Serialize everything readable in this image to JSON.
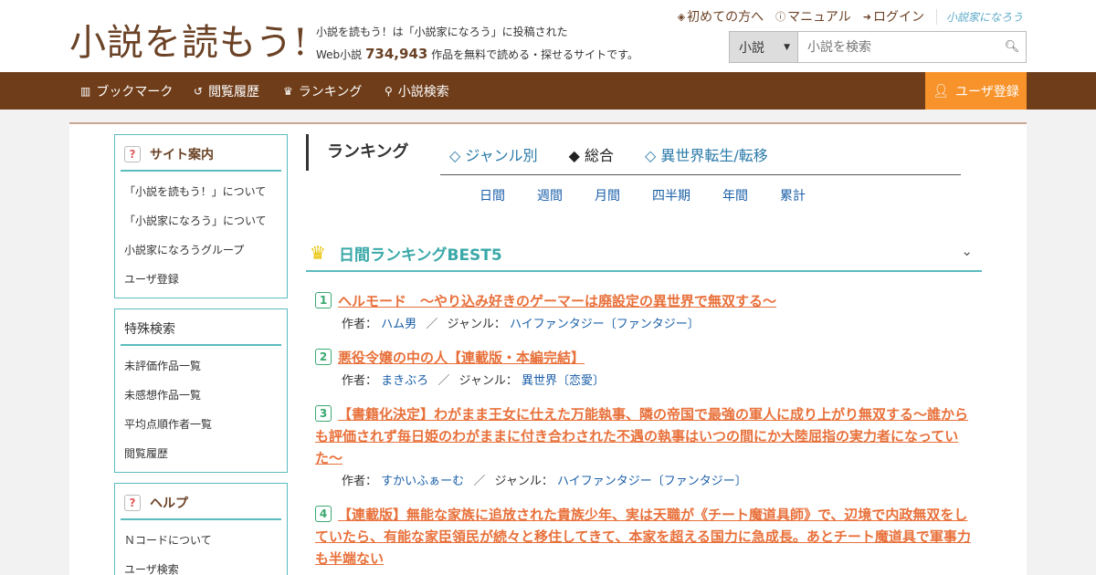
{
  "header": {
    "logo": "小説を読もう!",
    "tagline_1": "小説を読もう！は「小説家になろう」に投稿された",
    "tagline_2a": "Web小説",
    "work_count": "734,943",
    "tagline_2b": "作品を無料で読める・探せるサイトです。",
    "links": [
      {
        "label": "初めての方へ",
        "icon": "shield-icon"
      },
      {
        "label": "マニュアル",
        "icon": "question-circle-icon"
      },
      {
        "label": "ログイン",
        "icon": "login-icon"
      }
    ],
    "narou_logo": "小説家になろう"
  },
  "search": {
    "select_value": "小説",
    "placeholder": "小説を検索"
  },
  "nav": {
    "items": [
      {
        "label": "ブックマーク",
        "icon": "bookmark-icon"
      },
      {
        "label": "閲覧履歴",
        "icon": "history-icon"
      },
      {
        "label": "ランキング",
        "icon": "crown-icon"
      },
      {
        "label": "小説検索",
        "icon": "search-icon"
      }
    ],
    "register": "ユーザ登録"
  },
  "sidebar": {
    "site_guide": {
      "title": "サイト案内",
      "items": [
        "「小説を読もう！」について",
        "「小説家になろう」について",
        "小説家になろうグループ",
        "ユーザ登録"
      ]
    },
    "special_search": {
      "title": "特殊検索",
      "items": [
        "未評価作品一覧",
        "未感想作品一覧",
        "平均点順作者一覧",
        "閲覧履歴"
      ]
    },
    "help": {
      "title": "ヘルプ",
      "items": [
        "Ｎコードについて",
        "ユーザ検索"
      ]
    }
  },
  "ranking": {
    "title": "ランキング",
    "tabs": [
      {
        "label": "◇ ジャンル別",
        "active": false
      },
      {
        "label": "◆ 総合",
        "active": true
      },
      {
        "label": "◇ 異世界転生/転移",
        "active": false
      }
    ],
    "periods": [
      "日間",
      "週間",
      "月間",
      "四半期",
      "年間",
      "累計"
    ],
    "best_title": "日間ランキングBEST5",
    "meta_author_label": "作者：",
    "meta_genre_label": "ジャンル：",
    "items": [
      {
        "rank": "1",
        "title": "ヘルモード　～やり込み好きのゲーマーは廃設定の異世界で無双する～",
        "author": "ハム男",
        "genre": "ハイファンタジー〔ファンタジー〕"
      },
      {
        "rank": "2",
        "title": "悪役令嬢の中の人【連載版・本編完結】",
        "author": "まきぶろ",
        "genre": "異世界〔恋愛〕"
      },
      {
        "rank": "3",
        "title": "【書籍化決定】わがまま王女に仕えた万能執事、隣の帝国で最強の軍人に成り上がり無双する〜誰からも評価されず毎日姫のわがままに付き合わされた不遇の執事はいつの間にか大陸屈指の実力者になっていた〜",
        "author": "すかいふぁーむ",
        "genre": "ハイファンタジー〔ファンタジー〕"
      },
      {
        "rank": "4",
        "title": "【連載版】無能な家族に追放された貴族少年、実は天職が《チート魔道具師》で、辺境で内政無双をしていたら、有能な家臣領民が続々と移住してきて、本家を超える国力に急成長。あとチート魔道具で軍事力も半端ない",
        "author": "",
        "genre": ""
      }
    ]
  }
}
